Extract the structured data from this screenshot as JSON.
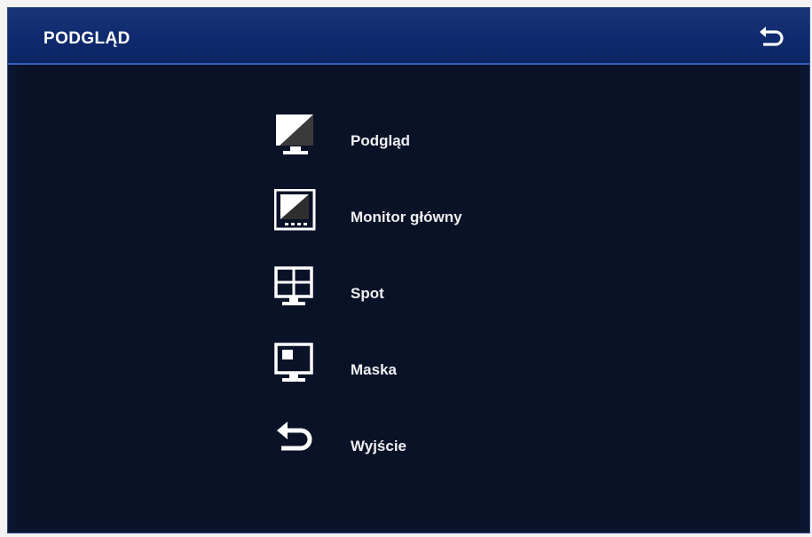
{
  "header": {
    "title": "PODGLĄD",
    "back_icon": "return-arrow-icon"
  },
  "menu": {
    "items": [
      {
        "label": "Podgląd",
        "icon": "monitor-split-icon"
      },
      {
        "label": "Monitor główny",
        "icon": "main-monitor-icon"
      },
      {
        "label": "Spot",
        "icon": "quad-monitor-icon"
      },
      {
        "label": "Maska",
        "icon": "mask-monitor-icon"
      },
      {
        "label": "Wyjście",
        "icon": "return-arrow-icon"
      }
    ]
  },
  "colors": {
    "titlebar": "#0f2a6e",
    "background": "#0a1228",
    "text": "#ffffff"
  }
}
